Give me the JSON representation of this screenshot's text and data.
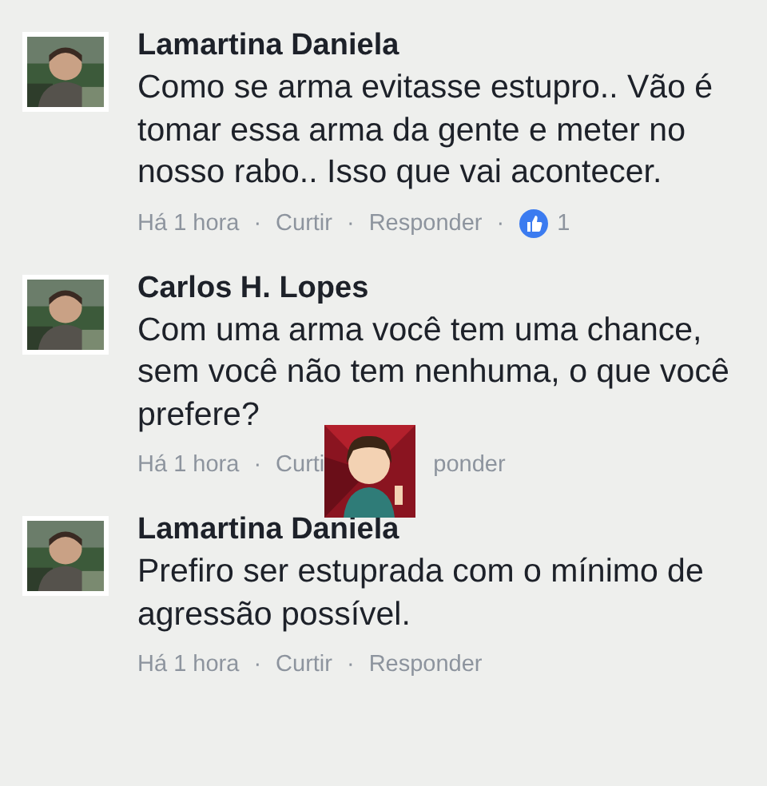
{
  "comments": [
    {
      "author": "Lamartina Daniela",
      "text": "Como se arma evitasse estupro.. Vão é tomar essa arma da gente e meter no nosso rabo.. Isso que vai acontecer.",
      "actions": [
        {
          "kind": "time",
          "text": "Há 1 hora"
        },
        {
          "kind": "dot",
          "text": "·"
        },
        {
          "kind": "link",
          "text": "Curtir"
        },
        {
          "kind": "dot",
          "text": "·"
        },
        {
          "kind": "link",
          "text": "Responder"
        },
        {
          "kind": "dot",
          "text": "·"
        },
        {
          "kind": "likes",
          "text": "1"
        }
      ]
    },
    {
      "author": "Carlos H. Lopes",
      "text": "Com uma arma você tem uma chance, sem você não tem nenhuma, o que você prefere?",
      "actions": [
        {
          "kind": "time",
          "text": "Há 1 hora"
        },
        {
          "kind": "dot",
          "text": "·"
        },
        {
          "kind": "link",
          "text": "Curti"
        },
        {
          "kind": "sticker"
        },
        {
          "kind": "link",
          "text": "ponder"
        }
      ]
    },
    {
      "author": "Lamartina Daniela",
      "text": "Prefiro ser estuprada com o mínimo de agressão possível.",
      "actions": [
        {
          "kind": "time",
          "text": "Há 1 hora"
        },
        {
          "kind": "dot",
          "text": "·"
        },
        {
          "kind": "link",
          "text": "Curtir"
        },
        {
          "kind": "dot",
          "text": "·"
        },
        {
          "kind": "link",
          "text": "Responder"
        }
      ]
    }
  ]
}
